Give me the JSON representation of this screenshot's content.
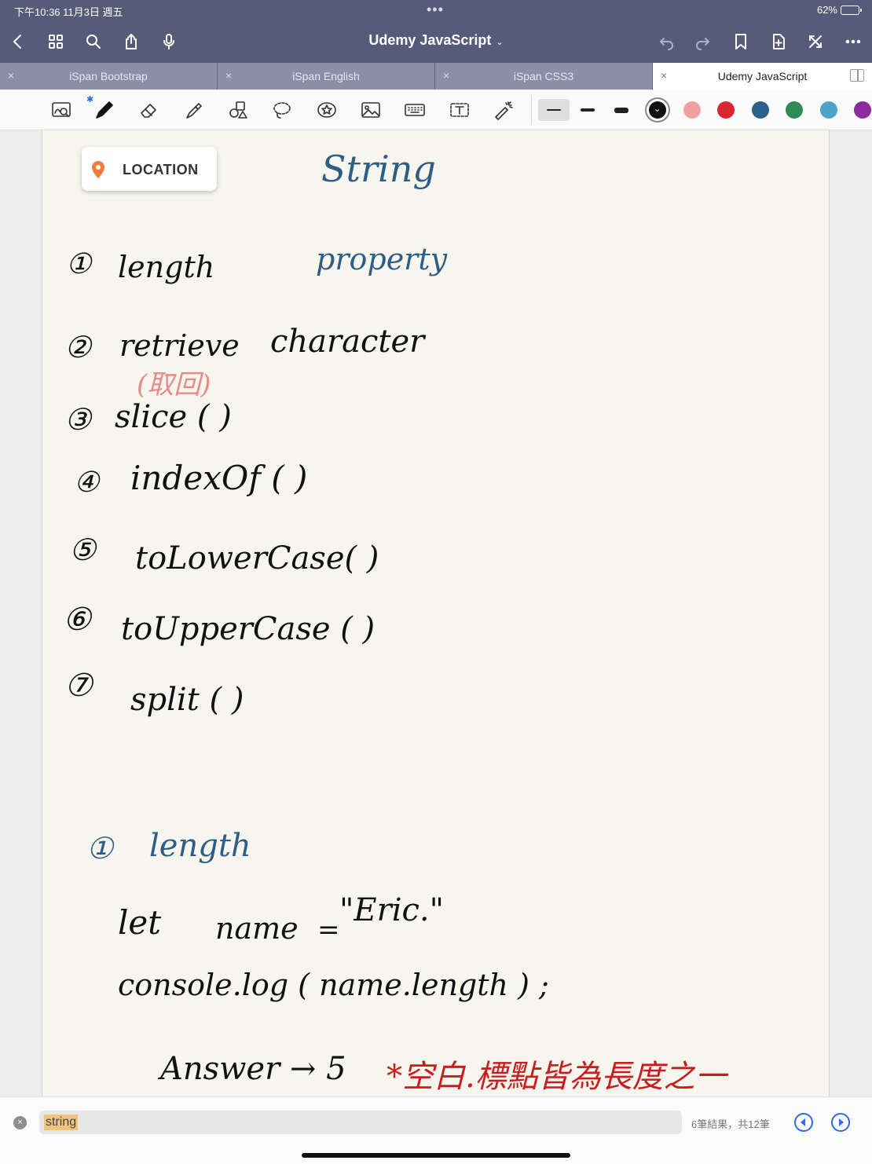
{
  "status_bar": {
    "time": "下午10:36   11月3日 週五",
    "dots": "•••",
    "battery_level": "62%",
    "battery_fraction": 0.62
  },
  "nav": {
    "title": "Udemy JavaScript",
    "title_caret": "⌄"
  },
  "tabs": [
    {
      "label": "iSpan Bootstrap",
      "active": false
    },
    {
      "label": "iSpan English",
      "active": false
    },
    {
      "label": "iSpan CSS3",
      "active": false
    },
    {
      "label": "Udemy JavaScript",
      "active": true
    }
  ],
  "tab_close_glyph": "×",
  "toolbar": {
    "bluetooth_glyph": "✱",
    "colors": [
      "#111111",
      "#f0a0a0",
      "#d9272d",
      "#2c5f8a",
      "#2e8b57",
      "#4aa3c8",
      "#8b2b9c"
    ],
    "selected_color_index": 0,
    "selected_stroke_index": 0
  },
  "page": {
    "location_chip": "LOCATION",
    "notes": {
      "title": "String",
      "item1_num": "①",
      "item1": "length",
      "item1_note": "property",
      "item2_num": "②",
      "item2": "retrieve",
      "item2_b": "character",
      "item2_note": "(取回)",
      "item3_num": "③",
      "item3": "slice ( )",
      "item4_num": "④",
      "item4": "indexOf ( )",
      "item5_num": "⑤",
      "item5": "toLowerCase( )",
      "item6_num": "⑥",
      "item6": "toUpperCase ( )",
      "item7_num": "⑦",
      "item7": "split ( )",
      "section_num": "①",
      "section_title": "length",
      "code_let": "let",
      "code_name": "name",
      "code_eq": "=",
      "code_value": "\"Eric.\"",
      "code_console": "console.log ( name.length ) ;",
      "answer": "Answer → 5",
      "answer_note": "*空白.標點皆為長度之一"
    }
  },
  "search": {
    "clear_glyph": "×",
    "query": "string",
    "result_count": "6筆結果，共12筆"
  }
}
